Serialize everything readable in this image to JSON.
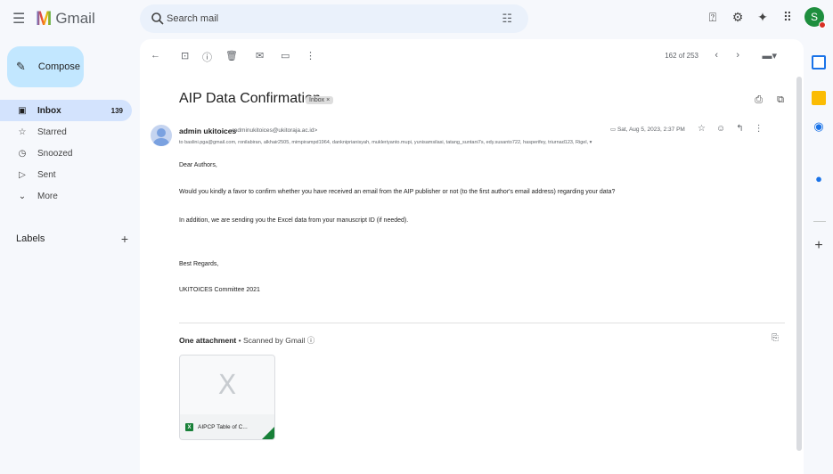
{
  "app": {
    "name": "Gmail"
  },
  "search": {
    "placeholder": "Search mail"
  },
  "sidebar": {
    "compose_label": "Compose",
    "items": [
      {
        "label": "Inbox",
        "count": "139",
        "icon": "inbox-icon"
      },
      {
        "label": "Starred",
        "count": "",
        "icon": "star-icon"
      },
      {
        "label": "Snoozed",
        "count": "",
        "icon": "clock-icon"
      },
      {
        "label": "Sent",
        "count": "",
        "icon": "send-icon"
      },
      {
        "label": "More",
        "count": "",
        "icon": "chevron-down-icon"
      }
    ],
    "labels_heading": "Labels"
  },
  "toolbar": {
    "pager": "162 of 253"
  },
  "email": {
    "subject": "AIP Data Confirmation",
    "chip": "Inbox ×",
    "sender_name": "admin ukitoices",
    "sender_email": "<adminukitoices@ukitoraja.ac.id>",
    "recipients": "to baslini.pga@gmail.com, ronilabiran, alkhair2505, mimpirampd1964, dankniprianisyah, mukleriyanto.mupi, yunisamsilasi, tatang_suntani7s, edy.susanto722, hasperifey, triurnad123, Rigel,",
    "date": "Sat, Aug 5, 2023, 2:37 PM",
    "body": {
      "greeting": "Dear Authors,",
      "para1": "Would you kindly a favor to confirm whether you have received an email from the AIP publisher or not (to the first author's email address) regarding your data?",
      "para2": "In addition, we are sending you the Excel data from your manuscript ID (if needed).",
      "closing": "Best Regards,",
      "signature": "UKITOICES Committee 2021"
    },
    "attachments_title": "One attachment",
    "attachments_sub": " • Scanned by Gmail ⓘ",
    "attachment": {
      "name": "AIPCP Table of C...",
      "badge": "X",
      "thumb_glyph": "X"
    }
  },
  "colors": {
    "accent": "#1a73e8",
    "compose_bg": "#c2e7ff",
    "active_nav": "#d3e3fd",
    "excel_green": "#188038"
  }
}
